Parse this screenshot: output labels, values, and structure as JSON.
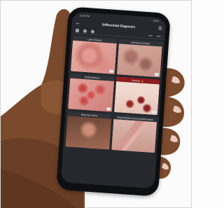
{
  "status": {
    "time": "12:30 PM",
    "battery": "100%"
  },
  "header": {
    "back_glyph": "←",
    "title": "Differential Diagnosis",
    "menu_glyph": "☰"
  },
  "toolbar_icons": [
    "camera-icon",
    "user-icon",
    "record-icon",
    "edit-icon",
    "filter-icon"
  ],
  "results": [
    {
      "label": "Lyme Disease",
      "alert": false
    },
    {
      "label": "Nummular Eczema",
      "alert": false
    },
    {
      "label": "Viral Exanthem",
      "alert": false
    },
    {
      "label": "Measles",
      "alert": true,
      "alert_glyph": "▲"
    },
    {
      "label": "Wool Hair Perive",
      "alert": false
    },
    {
      "label": "Drug-induced Lupus Erythematosus",
      "alert": false
    }
  ],
  "colors": {
    "alert": "#8d1c1f",
    "screen": "#26282d",
    "warning": "#ffd24a"
  }
}
